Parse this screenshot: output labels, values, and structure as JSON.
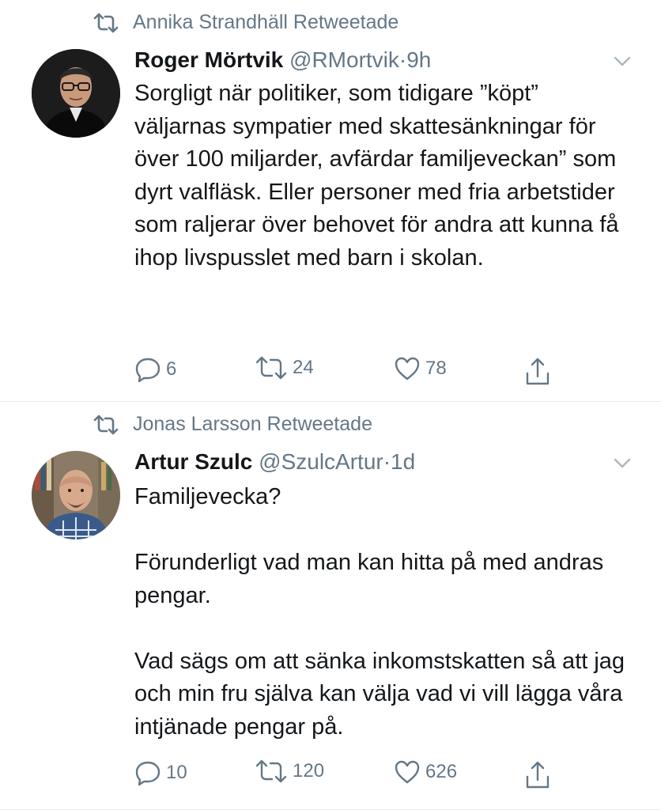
{
  "tweets": [
    {
      "retweeted_by": "Annika Strandhäll Retweetade",
      "name": "Roger Mörtvik",
      "handle": "@RMortvik",
      "separator": "·",
      "time": "9h",
      "paragraphs": [
        "Sorgligt när politiker, som tidigare ”köpt” väljarnas sympatier med skattesänkningar för över 100 miljarder, avfärdar familjeveckan” som dyrt valfläsk. Eller personer med fria arbetstider som raljerar över behovet för andra att kunna få ihop livspusslet med barn i skolan."
      ],
      "replies": "6",
      "retweets": "24",
      "likes": "78"
    },
    {
      "retweeted_by": "Jonas Larsson Retweetade",
      "name": "Artur Szulc",
      "handle": "@SzulcArtur",
      "separator": "·",
      "time": "1d",
      "paragraphs": [
        "Familjevecka?",
        "Förunderligt vad man kan hitta på med andras pengar.",
        "Vad sägs om att sänka inkomstskatten så att jag och min fru själva kan välja vad vi vill lägga våra intjänade pengar på."
      ],
      "replies": "10",
      "retweets": "120",
      "likes": "626"
    }
  ],
  "icons": {
    "retweet_indicator": "retweet-icon",
    "menu": "chevron-down-icon",
    "reply": "reply-icon",
    "retweet": "retweet-icon",
    "like": "heart-icon",
    "share": "share-icon"
  },
  "colors": {
    "text": "#14171a",
    "secondary": "#657786",
    "divider": "#e6ecf0"
  }
}
